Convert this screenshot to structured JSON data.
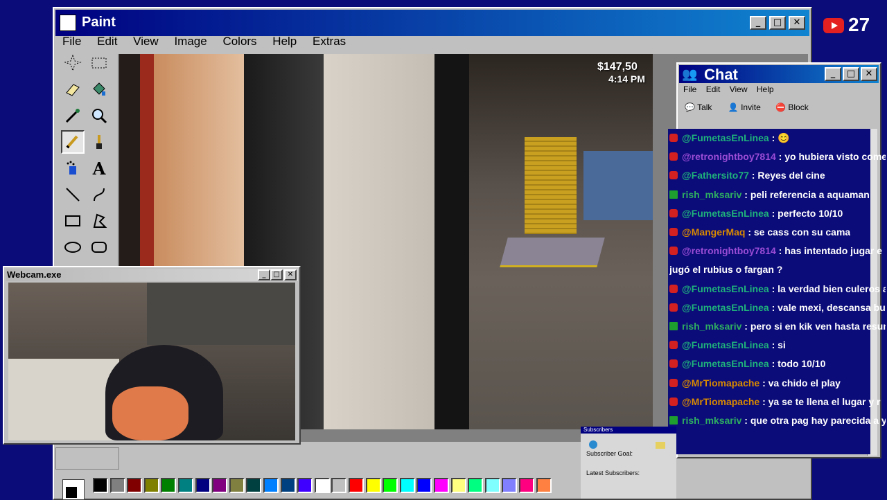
{
  "paint": {
    "title": "Paint",
    "menu": [
      "File",
      "Edit",
      "View",
      "Image",
      "Colors",
      "Help",
      "Extras"
    ]
  },
  "overlay": {
    "subscriber_count": "27",
    "game_money": "$147,50",
    "game_time": "4:14 PM"
  },
  "webcam": {
    "title": "Webcam.exe"
  },
  "chat": {
    "title": "Chat",
    "menu": [
      "File",
      "Edit",
      "View",
      "Help"
    ],
    "toolbar": [
      "Talk",
      "Invite",
      "Block"
    ],
    "messages": [
      {
        "user": "@FumetasEnLinea",
        "text": " : 😊",
        "color": "u",
        "badge": "r"
      },
      {
        "user": "@retronightboy7814",
        "text": " : yo hubiera visto come",
        "color": "p",
        "badge": "r"
      },
      {
        "user": "@Fathersito77",
        "text": " : Reyes del cine",
        "color": "u",
        "badge": "r"
      },
      {
        "user": "rish_mksariv",
        "text": " : peli referencia a aquaman",
        "color": "c",
        "badge": "g"
      },
      {
        "user": "@FumetasEnLinea",
        "text": " : perfecto 10/10",
        "color": "u",
        "badge": "r"
      },
      {
        "user": "@MangerMaq",
        "text": " : se cass con su cama",
        "color": "o",
        "badge": "r"
      },
      {
        "user": "@retronightboy7814",
        "text": " : has intentado jugar e",
        "color": "p",
        "badge": "r"
      },
      {
        "user": "",
        "text": "jugó el rubius o fargan ?",
        "color": "p",
        "badge": ""
      },
      {
        "user": "@FumetasEnLinea",
        "text": " : la verdad bien culeros a",
        "color": "u",
        "badge": "r"
      },
      {
        "user": "@FumetasEnLinea",
        "text": " : vale mexi, descansa bu",
        "color": "u",
        "badge": "r"
      },
      {
        "user": "rish_mksariv",
        "text": " : pero si en kik ven hasta resum",
        "color": "c",
        "badge": "g"
      },
      {
        "user": "@FumetasEnLinea",
        "text": " : si",
        "color": "u",
        "badge": "r"
      },
      {
        "user": "@FumetasEnLinea",
        "text": " : todo 10/10",
        "color": "u",
        "badge": "r"
      },
      {
        "user": "@MrTiomapache",
        "text": " : va chido el play",
        "color": "o",
        "badge": "r"
      },
      {
        "user": "@MrTiomapache",
        "text": " : ya se te llena el lugar y r",
        "color": "o",
        "badge": "r"
      },
      {
        "user": "rish_mksariv",
        "text": " : que otra pag hay parecida a y",
        "color": "c",
        "badge": "g"
      }
    ]
  },
  "subscribers": {
    "title": "Subscribers",
    "goal_label": "Subscriber Goal:",
    "latest_label": "Latest Subscribers:"
  },
  "palette": [
    "#000000",
    "#808080",
    "#800000",
    "#808000",
    "#008000",
    "#008080",
    "#000080",
    "#800080",
    "#808040",
    "#004040",
    "#0080ff",
    "#004080",
    "#4000ff",
    "#ffffff",
    "#c0c0c0",
    "#ff0000",
    "#ffff00",
    "#00ff00",
    "#00ffff",
    "#0000ff",
    "#ff00ff",
    "#ffff80",
    "#00ff80",
    "#80ffff",
    "#8080ff",
    "#ff0080",
    "#ff8040"
  ],
  "icons": [
    "free-select-icon",
    "select-icon",
    "eraser-icon",
    "fill-icon",
    "picker-icon",
    "magnifier-icon",
    "pencil-icon",
    "brush-icon",
    "airbrush-icon",
    "text-icon",
    "line-icon",
    "curve-icon",
    "rectangle-icon",
    "polygon-icon",
    "ellipse-icon",
    "rounded-rect-icon"
  ]
}
